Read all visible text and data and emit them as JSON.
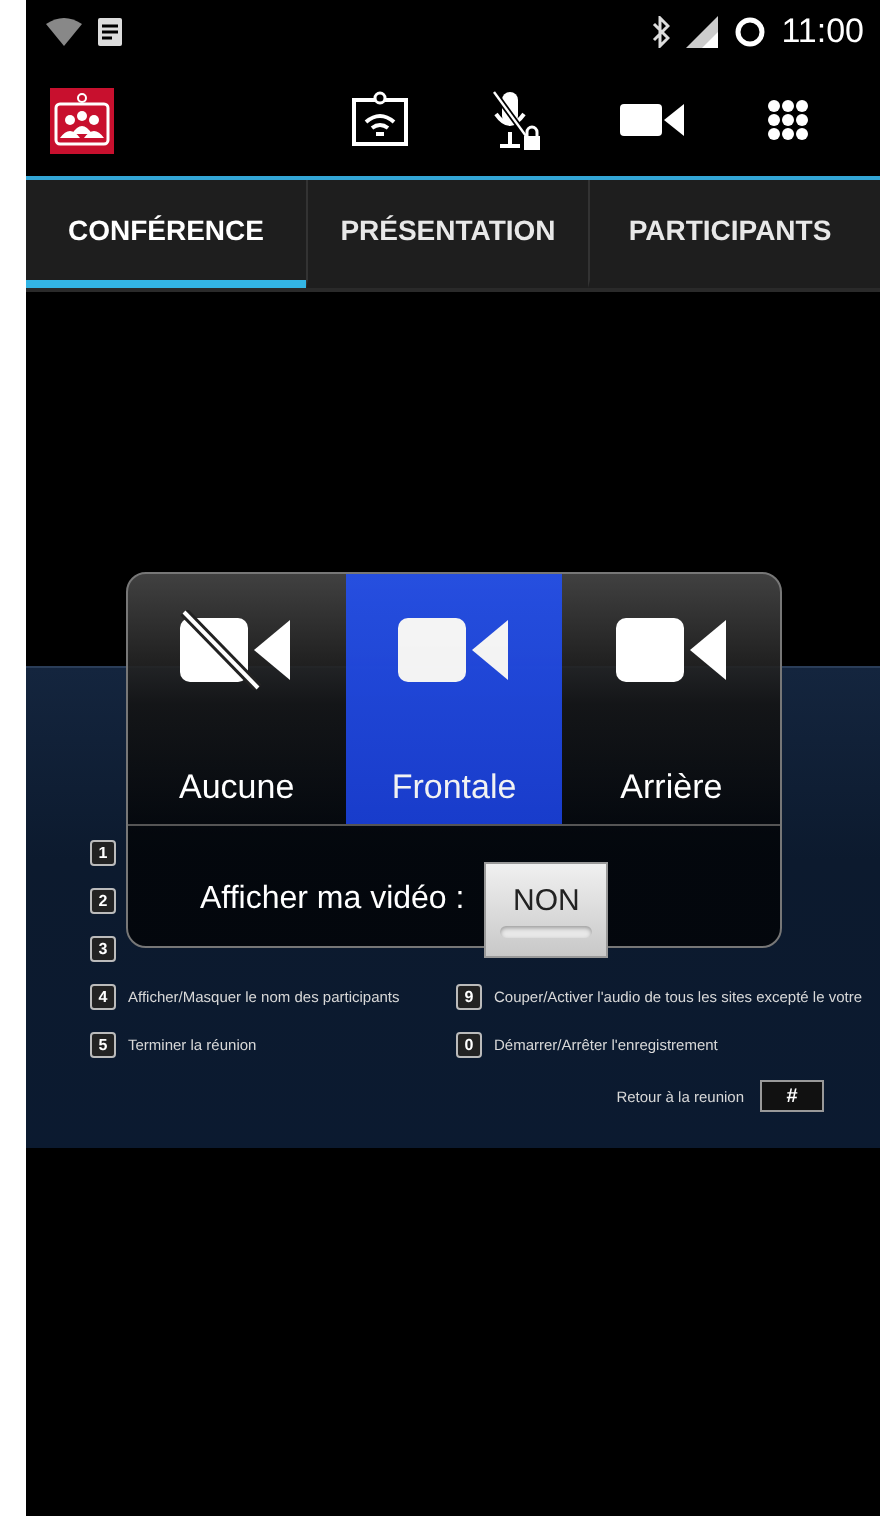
{
  "status_bar": {
    "time": "11:00"
  },
  "tabs": [
    {
      "label": "CONFÉRENCE",
      "selected": true
    },
    {
      "label": "PRÉSENTATION",
      "selected": false
    },
    {
      "label": "PARTICIPANTS",
      "selected": false
    }
  ],
  "moderator_menu": {
    "left_items": [
      {
        "key": "1"
      },
      {
        "key": "2"
      },
      {
        "key": "3"
      },
      {
        "key": "4",
        "label": "Afficher/Masquer le nom des participants"
      },
      {
        "key": "5",
        "label": "Terminer la réunion"
      }
    ],
    "right_items": [
      {
        "key": "9",
        "label": "Couper/Activer l'audio de tous les sites excepté le votre"
      },
      {
        "key": "0",
        "label": "Démarrer/Arrêter l'enregistrement"
      }
    ],
    "return": {
      "label": "Retour à la reunion",
      "key": "#"
    }
  },
  "video_dialog": {
    "options": [
      {
        "label": "Aucune",
        "kind": "off",
        "selected": false
      },
      {
        "label": "Frontale",
        "kind": "camera",
        "selected": true
      },
      {
        "label": "Arrière",
        "kind": "camera",
        "selected": false
      }
    ],
    "show_my_video": {
      "label": "Afficher ma vidéo :",
      "value": "NON",
      "on": false
    }
  }
}
